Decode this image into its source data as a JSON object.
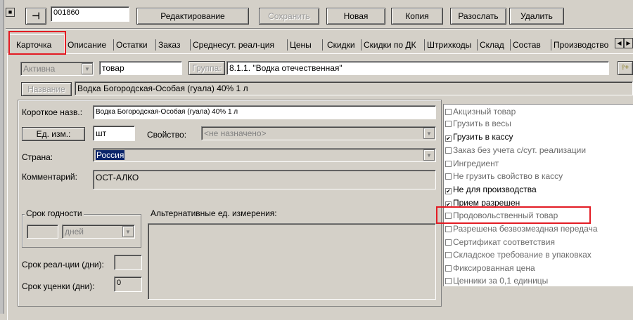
{
  "toolbar": {
    "pin_glyph": "⊣",
    "code_value": "001860",
    "edit_label": "Редактирование",
    "save_label": "Сохранить",
    "new_label": "Новая",
    "copy_label": "Копия",
    "send_label": "Разослать",
    "delete_label": "Удалить"
  },
  "tabs": [
    {
      "label": "Карточка",
      "active": true
    },
    {
      "label": "Описание"
    },
    {
      "label": "Остатки"
    },
    {
      "label": "Заказ"
    },
    {
      "label": "Среднесут. реал-ция"
    },
    {
      "label": "Цены"
    },
    {
      "label": "Скидки"
    },
    {
      "label": "Скидки по ДК"
    },
    {
      "label": "Штрихкоды"
    },
    {
      "label": "Склад"
    },
    {
      "label": "Состав"
    },
    {
      "label": "Производство"
    }
  ],
  "card": {
    "status_value": "Активна",
    "type_value": "товар",
    "group_button": "Группа:",
    "group_value": "8.1.1. \"Водка отечественная\"",
    "name_button": "Название",
    "name_value": "Водка Богородская-Особая (гуала) 40% 1 л",
    "short_name_label": "Короткое назв.:",
    "short_name_value": "Водка Богородская-Особая (гуала) 40% 1 л",
    "unit_button": "Ед. изм.:",
    "unit_value": "шт",
    "property_label": "Свойство:",
    "property_value": "<не назначено>",
    "country_label": "Страна:",
    "country_value": "Россия",
    "comment_label": "Комментарий:",
    "comment_value": "ОСТ-АЛКО",
    "shelf_life_legend": "Срок годности",
    "shelf_life_unit": "дней",
    "alt_units_label": "Альтернативные ед. измерения:",
    "sale_term_label": "Срок реал-ции (дни):",
    "markdown_term_label": "Срок уценки (дни):",
    "markdown_term_value": "0"
  },
  "flags": [
    {
      "label": "Акцизный товар",
      "checked": false
    },
    {
      "label": "Грузить в весы",
      "checked": false
    },
    {
      "label": "Грузить в кассу",
      "checked": true
    },
    {
      "label": "Заказ без учета с/сут. реализации",
      "checked": false
    },
    {
      "label": "Ингредиент",
      "checked": false
    },
    {
      "label": "Не грузить свойство в кассу",
      "checked": false
    },
    {
      "label": "Не для производства",
      "checked": true
    },
    {
      "label": "Прием разрешен",
      "checked": true
    },
    {
      "label": "Продовольственный товар",
      "checked": false
    },
    {
      "label": "Разрешена безвозмездная передача",
      "checked": false
    },
    {
      "label": "Сертификат соответствия",
      "checked": false
    },
    {
      "label": "Складское требование в упаковках",
      "checked": false
    },
    {
      "label": "Фиксированная цена",
      "checked": false
    },
    {
      "label": "Ценники за 0,1 единицы",
      "checked": false
    }
  ],
  "colors": {
    "highlight": "#e31b23",
    "selection": "#0a246a"
  }
}
